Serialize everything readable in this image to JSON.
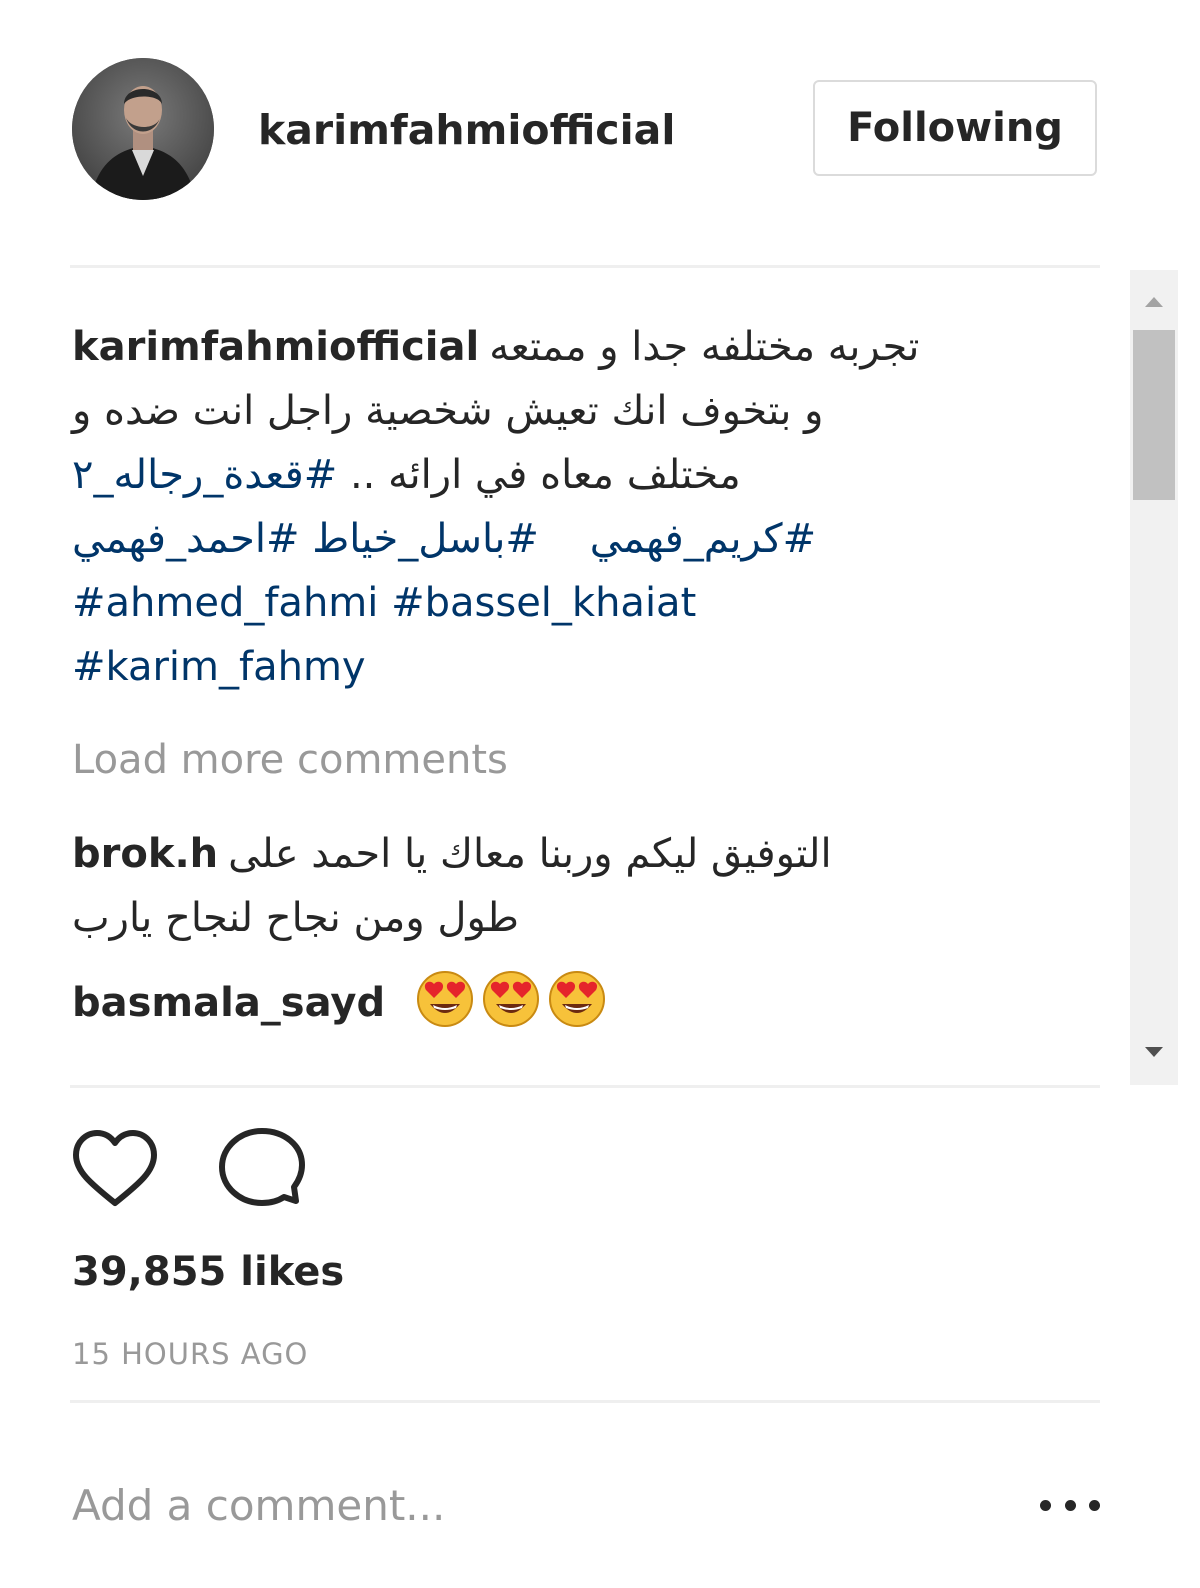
{
  "header": {
    "username": "karimfahmiofficial",
    "follow_label": "Following"
  },
  "caption": {
    "author": "karimfahmiofficial",
    "line1_ar": "تجربه مختلفه جدا و ممتعه",
    "line2_ar": "و بتخوف انك تعيش شخصية راجل انت ضده و",
    "line3_ar": "مختلف معاه في ارائه ..",
    "hashtag_1": "#قعدة_رجاله_٢",
    "hashtag_2": "#كريم_فهمي",
    "hashtag_3": "#باسل_خياط",
    "hashtag_4": "#احمد_فهمي",
    "hashtag_5": "#ahmed_fahmi",
    "hashtag_6": "#bassel_khaiat",
    "hashtag_7": "#karim_fahmy"
  },
  "load_more_label": "Load more comments",
  "comments": [
    {
      "author": "brok.h",
      "line1_ar": "التوفيق ليكم وربنا معاك يا احمد على",
      "line2_ar": "طول ومن نجاح لنجاح يارب"
    },
    {
      "author": "basmala_sayd",
      "emoji": "heart-eyes-emoji",
      "emoji_count": 3
    }
  ],
  "actions": {
    "like_icon": "heart-icon",
    "comment_icon": "speech-bubble-icon"
  },
  "likes_text": "39,855 likes",
  "timestamp": "15 HOURS AGO",
  "comment_input": {
    "placeholder": "Add a comment..."
  },
  "more_icon": "ellipsis-icon",
  "colors": {
    "text": "#262626",
    "hashtag": "#003569",
    "muted": "#999999",
    "border": "#dbdbdb"
  }
}
